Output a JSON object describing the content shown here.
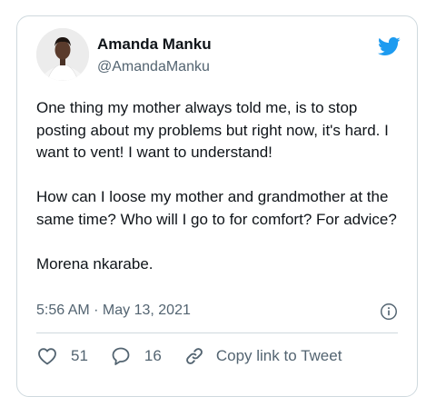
{
  "author": {
    "name": "Amanda Manku",
    "handle": "@AmandaManku"
  },
  "tweet": {
    "paragraphs": [
      "One thing my mother always told me, is to stop posting about my problems but right now, it's hard. I want to vent! I want to understand!",
      "How can I loose my mother and grandmother at the same time? Who will I go to for comfort? For advice?",
      "Morena nkarabe."
    ],
    "timestamp": "5:56 AM · May 13, 2021"
  },
  "actions": {
    "likes": "51",
    "replies": "16",
    "copy_link": "Copy link to Tweet"
  },
  "icons": {
    "brand": "twitter-bird-icon",
    "info": "info-icon",
    "like": "heart-icon",
    "reply": "reply-bubble-icon",
    "copy": "link-icon"
  },
  "colors": {
    "twitter_blue": "#1d9bf0",
    "text": "#0f1419",
    "muted": "#536471",
    "border": "#cfd9de"
  }
}
